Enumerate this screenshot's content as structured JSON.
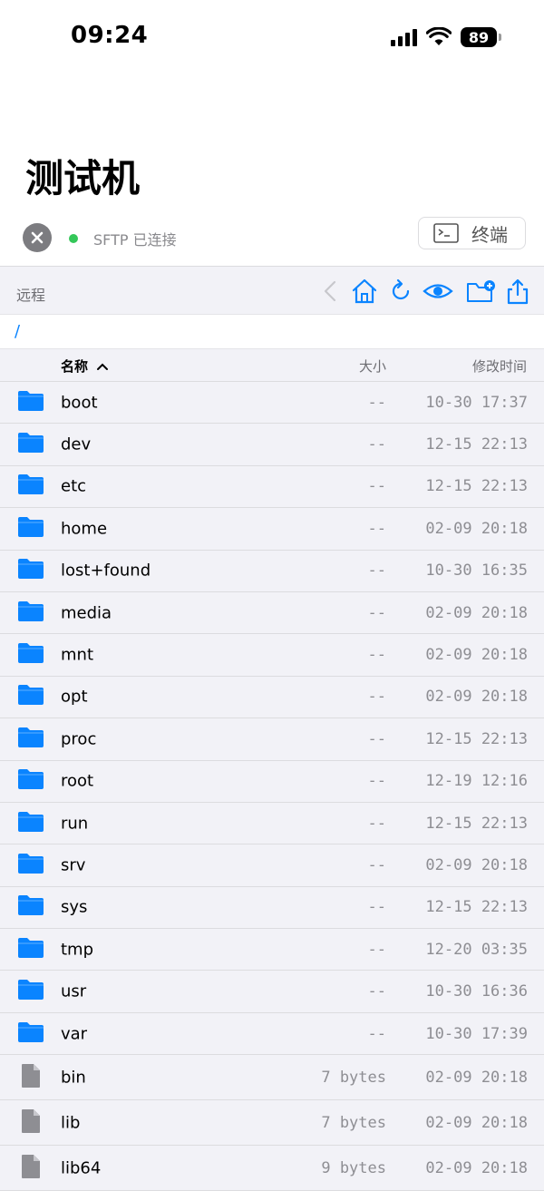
{
  "status_bar": {
    "time": "09:24",
    "battery": "89"
  },
  "title": "测试机",
  "connection": {
    "status": "SFTP 已连接",
    "terminal_label": "终端"
  },
  "toolbar": {
    "label": "远程"
  },
  "path": "/",
  "columns": {
    "name": "名称",
    "size": "大小",
    "modified": "修改时间"
  },
  "colors": {
    "accent": "#0a84ff",
    "connected": "#34c759",
    "file_icon": "#8e8e93"
  },
  "entries": [
    {
      "type": "folder",
      "name": "boot",
      "size": "--",
      "modified": "10-30 17:37"
    },
    {
      "type": "folder",
      "name": "dev",
      "size": "--",
      "modified": "12-15 22:13"
    },
    {
      "type": "folder",
      "name": "etc",
      "size": "--",
      "modified": "12-15 22:13"
    },
    {
      "type": "folder",
      "name": "home",
      "size": "--",
      "modified": "02-09 20:18"
    },
    {
      "type": "folder",
      "name": "lost+found",
      "size": "--",
      "modified": "10-30 16:35"
    },
    {
      "type": "folder",
      "name": "media",
      "size": "--",
      "modified": "02-09 20:18"
    },
    {
      "type": "folder",
      "name": "mnt",
      "size": "--",
      "modified": "02-09 20:18"
    },
    {
      "type": "folder",
      "name": "opt",
      "size": "--",
      "modified": "02-09 20:18"
    },
    {
      "type": "folder",
      "name": "proc",
      "size": "--",
      "modified": "12-15 22:13"
    },
    {
      "type": "folder",
      "name": "root",
      "size": "--",
      "modified": "12-19 12:16"
    },
    {
      "type": "folder",
      "name": "run",
      "size": "--",
      "modified": "12-15 22:13"
    },
    {
      "type": "folder",
      "name": "srv",
      "size": "--",
      "modified": "02-09 20:18"
    },
    {
      "type": "folder",
      "name": "sys",
      "size": "--",
      "modified": "12-15 22:13"
    },
    {
      "type": "folder",
      "name": "tmp",
      "size": "--",
      "modified": "12-20 03:35"
    },
    {
      "type": "folder",
      "name": "usr",
      "size": "--",
      "modified": "10-30 16:36"
    },
    {
      "type": "folder",
      "name": "var",
      "size": "--",
      "modified": "10-30 17:39"
    },
    {
      "type": "file",
      "name": "bin",
      "size": "7 bytes",
      "modified": "02-09 20:18"
    },
    {
      "type": "file",
      "name": "lib",
      "size": "7 bytes",
      "modified": "02-09 20:18"
    },
    {
      "type": "file",
      "name": "lib64",
      "size": "9 bytes",
      "modified": "02-09 20:18"
    }
  ]
}
